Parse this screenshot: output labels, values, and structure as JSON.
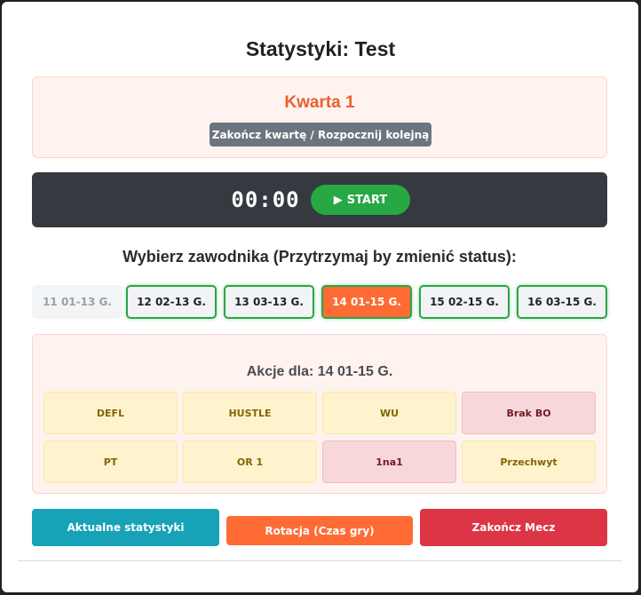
{
  "page": {
    "title": "Statystyki: Test"
  },
  "quarter": {
    "title": "Kwarta 1",
    "end_button_label": "Zakończ kwartę / Rozpocznij kolejną"
  },
  "timer": {
    "display": "00:00",
    "start_icon": "▶",
    "start_label": "START"
  },
  "players": {
    "heading": "Wybierz zawodnika (Przytrzymaj by zmienić status):",
    "items": [
      {
        "label": "11 01-13 G.",
        "state": "inactive"
      },
      {
        "label": "12 02-13 G.",
        "state": "active"
      },
      {
        "label": "13 03-13 G.",
        "state": "active"
      },
      {
        "label": "14 01-15 G.",
        "state": "selected"
      },
      {
        "label": "15 02-15 G.",
        "state": "active"
      },
      {
        "label": "16 03-15 G.",
        "state": "active"
      }
    ]
  },
  "actions": {
    "heading": "Akcje dla: 14 01-15 G.",
    "items": [
      {
        "label": "DEFL",
        "style": "warning"
      },
      {
        "label": "HUSTLE",
        "style": "warning"
      },
      {
        "label": "WU",
        "style": "warning"
      },
      {
        "label": "Brak BO",
        "style": "danger"
      },
      {
        "label": "PT",
        "style": "warning"
      },
      {
        "label": "OR 1",
        "style": "warning"
      },
      {
        "label": "1na1",
        "style": "danger"
      },
      {
        "label": "Przechwyt",
        "style": "warning"
      }
    ]
  },
  "footer": {
    "current_stats_label": "Aktualne statystyki",
    "rotation_label": "Rotacja (Czas gry)",
    "end_match_label": "Zakończ Mecz"
  },
  "colors": {
    "accent_orange": "#ff6b35",
    "success_green": "#28a745",
    "teal": "#17a2b8",
    "danger_red": "#dc3545",
    "dark_bar": "#343a40"
  }
}
